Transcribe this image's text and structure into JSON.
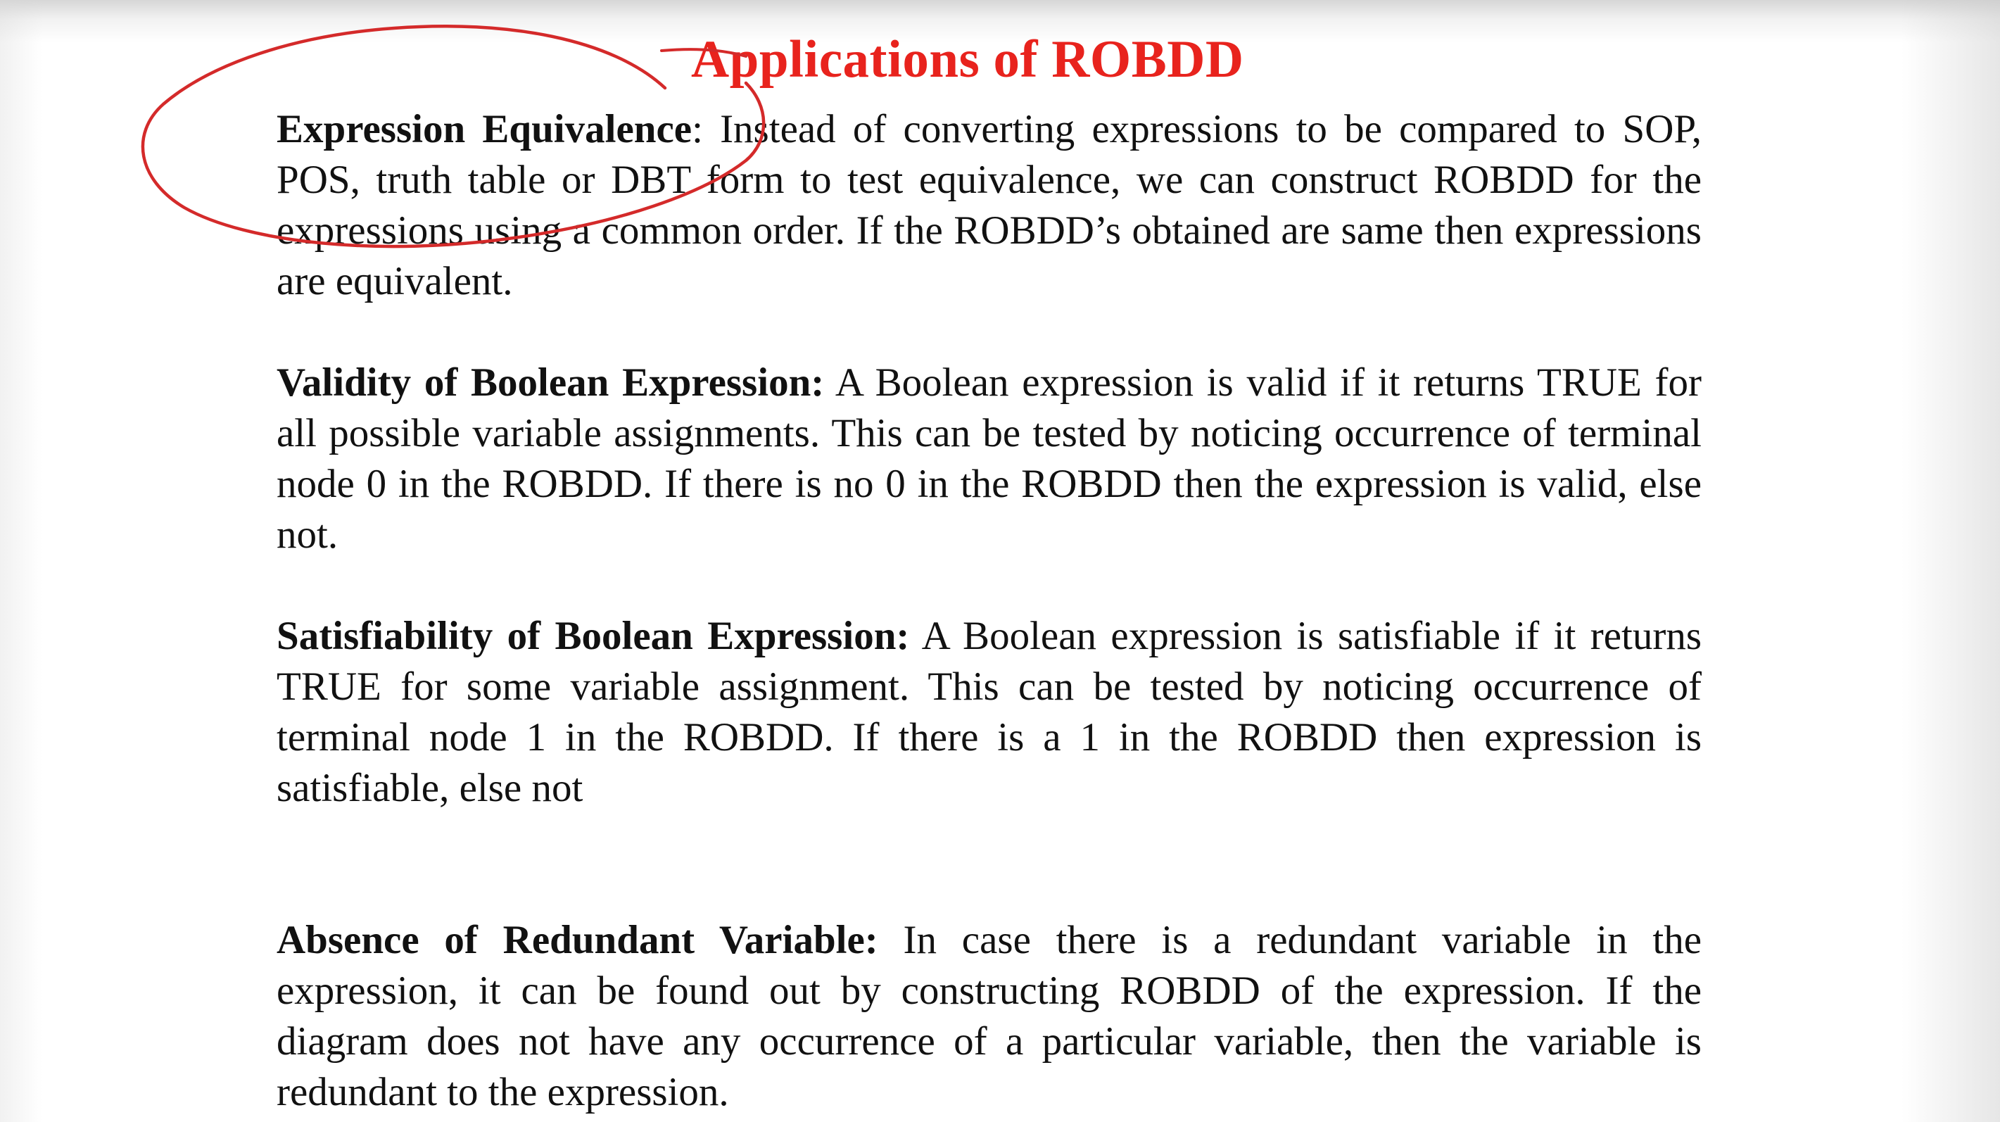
{
  "slide": {
    "title": "Applications of ROBDD",
    "sections": [
      {
        "term": "Expression Equivalence",
        "separator": ": ",
        "body": "Instead of converting expressions to be compared to SOP, POS, truth table or DBT form to test equivalence, we can construct ROBDD for the expressions using a common order. If the ROBDD’s obtained are same then expressions are equivalent."
      },
      {
        "term": "Validity of Boolean Expression:",
        "separator": " ",
        "body": "A Boolean expression is valid if it returns TRUE for all possible variable assignments. This can be tested by noticing occurrence of terminal node 0 in the ROBDD. If there is no 0 in the ROBDD then the expression is valid, else not."
      },
      {
        "term": "Satisfiability of Boolean Expression:",
        "separator": " ",
        "body": "A Boolean expression is satisfiable if it returns TRUE for some variable assignment. This can be tested by noticing occurrence of terminal node 1 in the ROBDD. If there is a 1 in the ROBDD then expression is satisfiable, else not"
      },
      {
        "term": "Absence of Redundant Variable:",
        "separator": " ",
        "body": "In case there is a redundant variable in the expression, it can be found out by constructing ROBDD of the expression. If the diagram does not have any occurrence of a particular variable, then the variable is redundant to the expression."
      }
    ]
  },
  "colors": {
    "title": "#e8231d",
    "annotation_ink": "#d42a2a",
    "text": "#111111",
    "background": "#ffffff"
  }
}
